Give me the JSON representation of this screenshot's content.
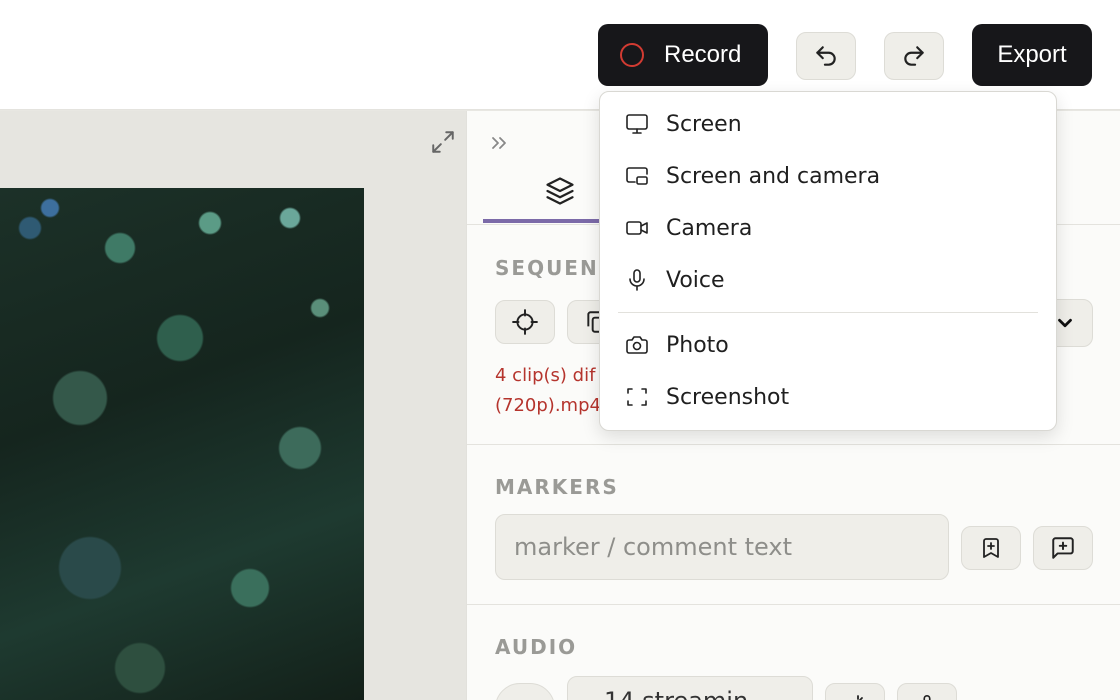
{
  "toolbar": {
    "record_label": "Record",
    "export_label": "Export",
    "undo_icon": "undo-icon",
    "redo_icon": "redo-icon"
  },
  "record_menu": {
    "items": [
      {
        "label": "Screen",
        "icon": "monitor-icon"
      },
      {
        "label": "Screen and camera",
        "icon": "screen-camera-icon"
      },
      {
        "label": "Camera",
        "icon": "video-camera-icon"
      },
      {
        "label": "Voice",
        "icon": "microphone-icon"
      },
      {
        "label": "Photo",
        "icon": "photo-camera-icon"
      },
      {
        "label": "Screenshot",
        "icon": "screenshot-frame-icon"
      }
    ]
  },
  "panel": {
    "sequence_label": "SEQUENC",
    "warning_line1": "4 clip(s) dif",
    "warning_line2": "(720p).mp4",
    "markers_label": "MARKERS",
    "marker_placeholder": "marker / comment text",
    "audio_label": "AUDIO",
    "audio_select_value": "14 streamin"
  },
  "colors": {
    "accent_tab": "#7b6aa8",
    "record_dot": "#d23b32",
    "warning": "#b5342d",
    "dark_button": "#17171a"
  }
}
